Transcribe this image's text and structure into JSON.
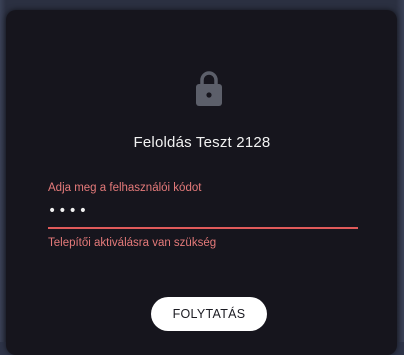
{
  "dialog": {
    "icon": "lock-icon",
    "title": "Feloldás Teszt 2128",
    "field": {
      "label": "Adja meg a felhasználói kódot",
      "value": "••••",
      "error": "Telepítői aktiválásra van szükség"
    },
    "continue_label": "FOLYTATÁS"
  },
  "colors": {
    "background": "#2b3041",
    "dialog": "#16151d",
    "error": "#e05a5a",
    "button": "#ffffff"
  }
}
